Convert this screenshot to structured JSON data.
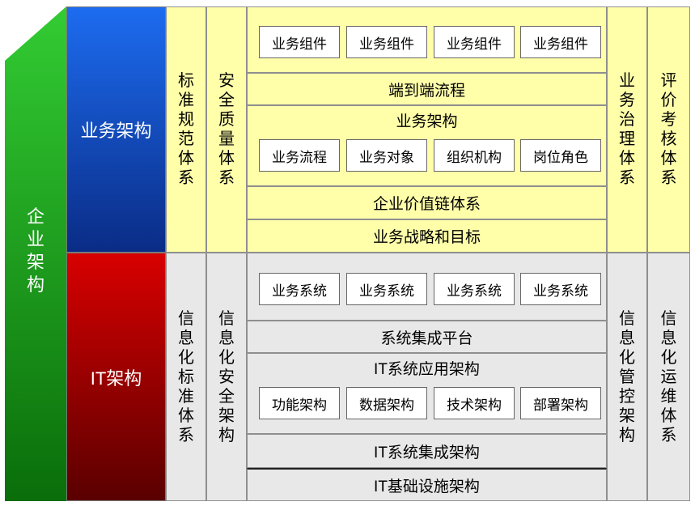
{
  "colors": {
    "enterprise_green": "#2DB82D",
    "business_blue": "#1155E0",
    "it_red": "#CC0000",
    "business_bg": "#FFFFAA",
    "it_bg": "#E8E8E8"
  },
  "enterprise": {
    "label": "企业架构"
  },
  "business": {
    "label": "业务架构",
    "left_col1": "标准规范体系",
    "left_col2": "安全质量体系",
    "right_col1": "业务治理体系",
    "right_col2": "评价考核体系",
    "components": [
      "业务组件",
      "业务组件",
      "业务组件",
      "业务组件"
    ],
    "end_to_end": "端到端流程",
    "arch_title": "业务架构",
    "arch_items": [
      "业务流程",
      "业务对象",
      "组织机构",
      "岗位角色"
    ],
    "value_chain": "企业价值链体系",
    "strategy": "业务战略和目标"
  },
  "it": {
    "label": "IT架构",
    "left_col1": "信息化标准体系",
    "left_col2": "信息化安全架构",
    "right_col1": "信息化管控架构",
    "right_col2": "信息化运维体系",
    "systems": [
      "业务系统",
      "业务系统",
      "业务系统",
      "业务系统"
    ],
    "integration_platform": "系统集成平台",
    "app_arch_title": "IT系统应用架构",
    "app_arch_items": [
      "功能架构",
      "数据架构",
      "技术架构",
      "部署架构"
    ],
    "integration_arch": "IT系统集成架构",
    "infrastructure": "IT基础设施架构"
  }
}
